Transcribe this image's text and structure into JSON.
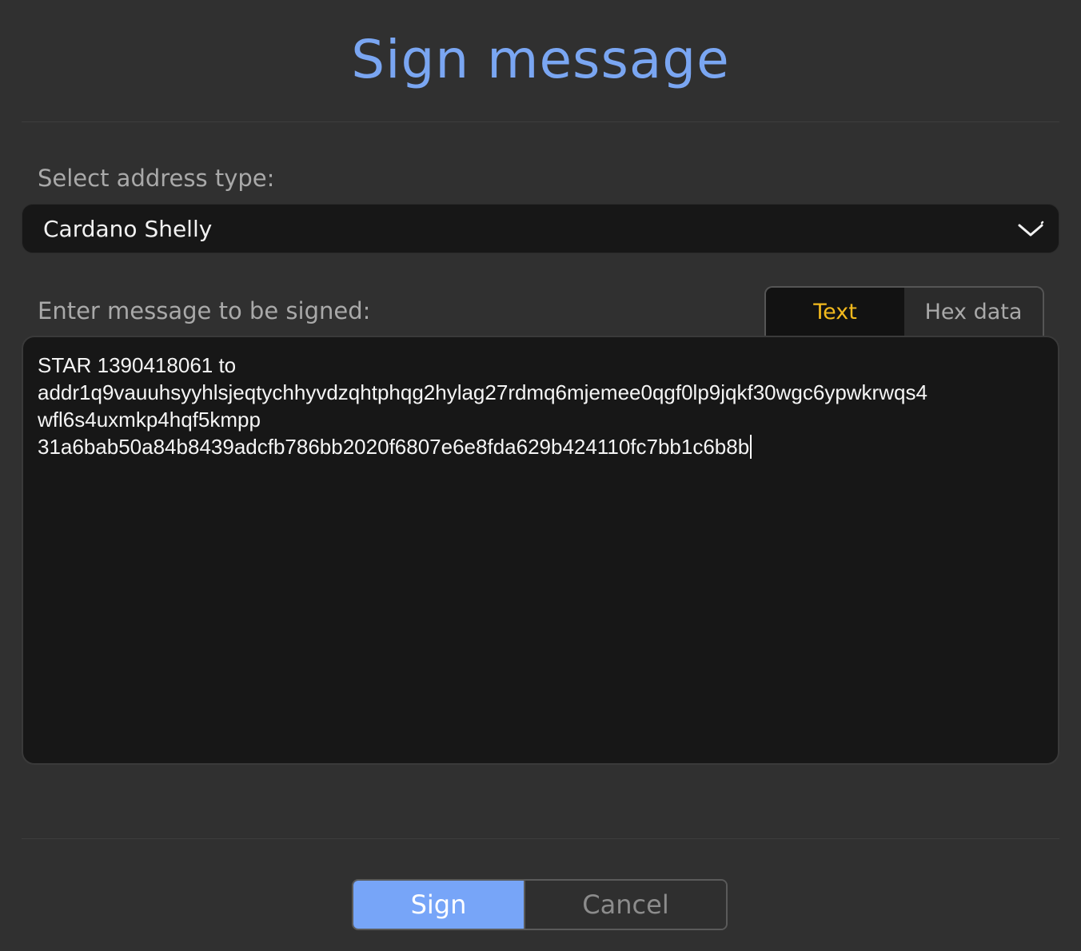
{
  "dialog": {
    "title": "Sign message"
  },
  "address_type": {
    "label": "Select address type:",
    "selected": "Cardano Shelly"
  },
  "message": {
    "label": "Enter message to be signed:",
    "modes": [
      {
        "label": "Text",
        "active": true
      },
      {
        "label": "Hex data",
        "active": false
      }
    ],
    "lines": [
      "STAR 1390418061 to",
      "addr1q9vauuhsyyhlsjeqtychhyvdzqhtphqg2hylag27rdmq6mjemee0qgf0lp9jqkf30wgc6ypwkrwqs4",
      "wfl6s4uxmkp4hqf5kmpp",
      "31a6bab50a84b8439adcfb786bb2020f6807e6e8fda629b424110fc7bb1c6b8b"
    ]
  },
  "actions": {
    "sign_label": "Sign",
    "cancel_label": "Cancel"
  },
  "colors": {
    "accent": "#7aa6f2",
    "active_mode": "#f2b91d",
    "sign_button": "#77a5f8",
    "background": "#303030"
  }
}
